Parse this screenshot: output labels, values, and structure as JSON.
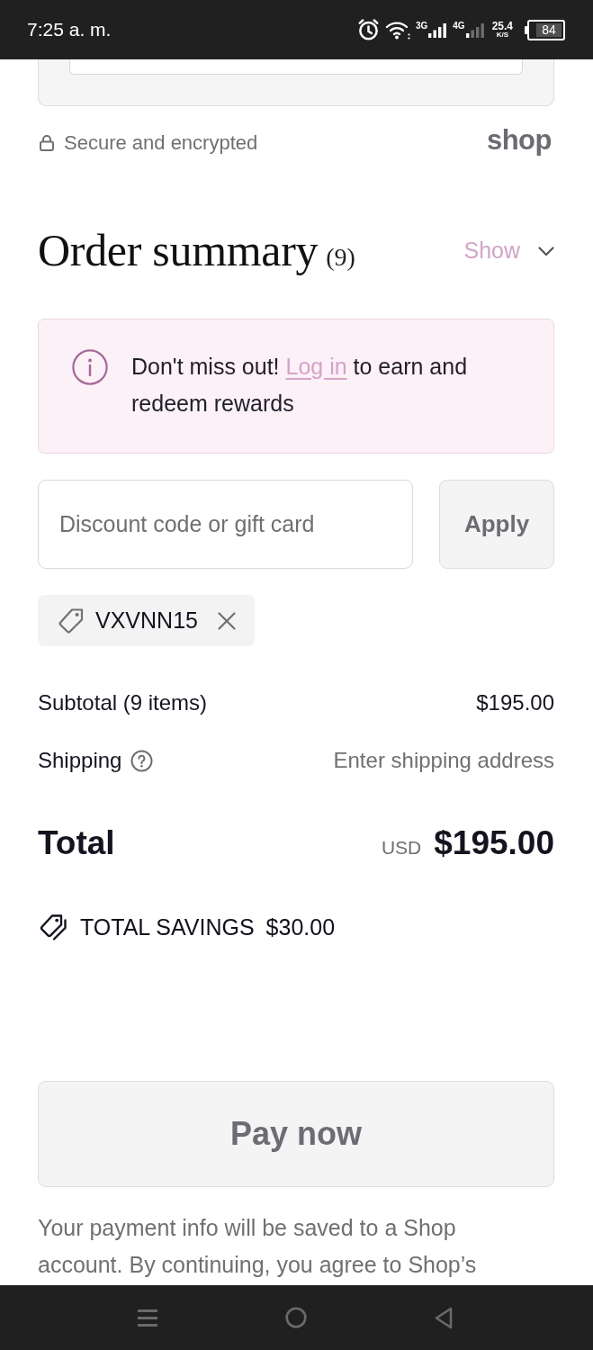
{
  "status_bar": {
    "time": "7:25 a. m.",
    "sim1_type": "3G",
    "sim2_type": "4G",
    "speed": "25.4",
    "speed_unit": "K/S",
    "battery": "84"
  },
  "secure_note": {
    "text": "Secure and encrypted",
    "brand": "shop"
  },
  "order_summary": {
    "title": "Order summary",
    "count": "(9)",
    "toggle": "Show",
    "expanded": false
  },
  "rewards_notice": {
    "text_before": "Don't miss out!",
    "link": "Log in",
    "text_after": "to earn and redeem rewards"
  },
  "discount": {
    "placeholder": "Discount code or gift card",
    "button": "Apply",
    "button_disabled": true,
    "applied_codes": [
      {
        "code": "VXVNN15"
      }
    ]
  },
  "summary_rows": [
    {
      "kind": "amount",
      "label": "Subtotal (9 items)",
      "value": "$195.00",
      "help": false
    },
    {
      "kind": "note",
      "label": "Shipping",
      "value": "Enter shipping address",
      "help": true
    }
  ],
  "total": {
    "label": "Total",
    "currency": "USD",
    "amount": "$195.00"
  },
  "savings": {
    "label": "TOTAL SAVINGS",
    "amount": "$30.00"
  },
  "pay_button": {
    "label": "Pay now",
    "disabled": true
  },
  "legal_text": "Your payment info will be saved to a Shop account. By continuing, you agree to Shop’s"
}
